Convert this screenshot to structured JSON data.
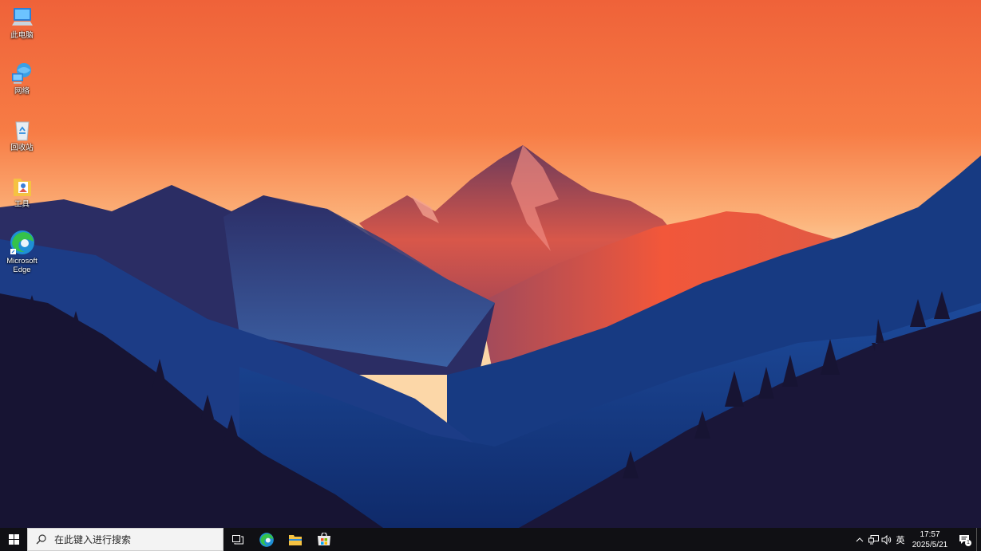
{
  "desktop": {
    "icons": [
      {
        "label": "此电脑",
        "icon": "computer-icon"
      },
      {
        "label": "网络",
        "icon": "network-icon"
      },
      {
        "label": "回收站",
        "icon": "recycle-bin-icon"
      },
      {
        "label": "工具",
        "icon": "folder-icon"
      },
      {
        "label": "Microsoft Edge",
        "icon": "edge-icon"
      }
    ],
    "wallpaper": "mountain-sunset-wallpaper"
  },
  "taskbar": {
    "start_icon": "windows-logo-icon",
    "search": {
      "placeholder": "在此键入进行搜索",
      "icon": "search-icon"
    },
    "apps": [
      {
        "name": "Task View",
        "icon": "task-view-icon"
      },
      {
        "name": "Microsoft Edge",
        "icon": "edge-icon"
      },
      {
        "name": "File Explorer",
        "icon": "folder-icon"
      },
      {
        "name": "Microsoft Store",
        "icon": "store-icon"
      }
    ],
    "tray": {
      "overflow_icon": "chevron-up-icon",
      "network_icon": "network-tray-icon",
      "volume_icon": "speaker-icon",
      "ime": "英",
      "time": "17:57",
      "date": "2025/5/21",
      "notification_count": "1"
    }
  },
  "colors": {
    "sky_top": "#f26a3c",
    "sky_horizon": "#fbc99a",
    "taskbar": "#101014",
    "search_box": "#f3f3f3"
  }
}
